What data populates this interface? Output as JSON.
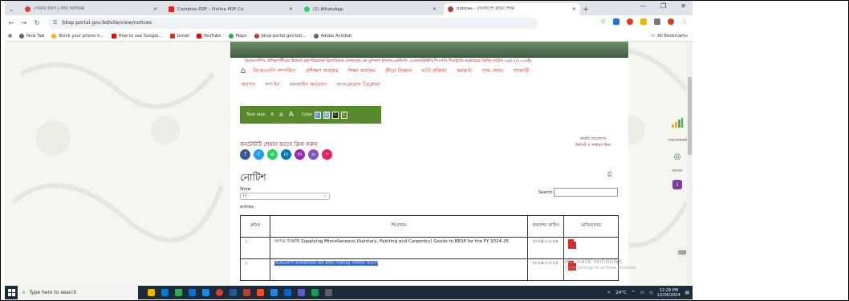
{
  "tabs": [
    {
      "title": "সোনার হরিণ | বাবি বিশেষজ্ঞ",
      "color": "#e23b2e",
      "active": false
    },
    {
      "title": "Combine PDF – Online PDF Co",
      "color": "#e2231a",
      "active": false
    },
    {
      "title": "(2) WhatsApp",
      "color": "#25d366",
      "active": false
    },
    {
      "title": "notices - বাংলাদেশ ক্রীড়া শিক্ষা",
      "color": "#c0392b",
      "active": true
    }
  ],
  "address": {
    "url": "bksp.portal.gov.bd/site/view/notices"
  },
  "bookmarks": [
    {
      "label": "New Tab",
      "color": "#5f6368"
    },
    {
      "label": "Block your phone n...",
      "color": "#f5b400"
    },
    {
      "label": "How to use Google...",
      "color": "#ff0000"
    },
    {
      "label": "Gmail",
      "color": "#d93025"
    },
    {
      "label": "YouTube",
      "color": "#ff0000"
    },
    {
      "label": "Maps",
      "color": "#34a853"
    },
    {
      "label": "bksp.portal.gov.bd/...",
      "color": "#c0392b"
    },
    {
      "label": "Adobe Acrobat",
      "color": "#5f6368"
    }
  ],
  "all_bookmarks": "All Bookmarks",
  "site": {
    "marquee": "বিকেএসপি'র প্রশিক্ষণার্থীদের উদ্দেশে মহাপরিচালক ব্রিগেডিয়ার জেনারেল মো.মুনিরুল ইসলাম,এনডিসি ,এএফডব্লিউসি,পিএসসি,পিএইচডি মহোদয়ের ব্রিফিং   তারিখ:২৯/০২/২০২৪ইং",
    "menu1": [
      "বিকেএসপি সম্পর্কিত",
      "প্রশিক্ষণ কার্যক্রম",
      "শিক্ষা কার্যক্রম",
      "ক্রীড়া বিজ্ঞান",
      "ভর্তি প্রক্রিয়া",
      "কর্মকর্তা",
      "তথ্য প্রদান",
      "গ্যালারী"
    ],
    "menu2": [
      "অ্যাপস",
      "লগ ইন",
      "অনলাইন আবেদন",
      "আনকোরাল ডিপ্লোমা"
    ],
    "textsize": {
      "label": "Text size",
      "a_small": "A",
      "a_mid": "A",
      "a_big": "A",
      "color_label": "Color",
      "color_opts": [
        "C",
        "C",
        "C",
        "C"
      ]
    },
    "share_text": "কনটেন্টটি শেয়ার করতে ক্লিক করুন",
    "side_info": "জরুরি প্রয়োজনে ভিজিট ও সাধারণ ফিড",
    "notice_title": "নোটিশ",
    "show_label": "Show",
    "show_value": "10",
    "entries_label": "entries",
    "search_label": "Search:",
    "table": {
      "headers": [
        "ক্রমিক",
        "শিরোনাম",
        "প্রকাশের তারিখ",
        "ডাউনলোড"
      ],
      "rows": [
        {
          "sn": "১",
          "title": "দরপত্র বিজ্ঞপ্তি Supplying Miscellaneous (Sanitary, Painting and Carpentry) Goods to BKSP for the FY 2024-25",
          "date": "২০২৪-১২-২৬",
          "highlight": false
        },
        {
          "sn": "২",
          "title": "বিকেএসপি আন্তর্জাতিক বিশ্ব ক্রীড়া সপ্তাহের সরকারি আদেশ",
          "date": "২০২৪-১২-২৫",
          "highlight": true
        }
      ]
    }
  },
  "right_panel": {
    "item1": "সেবাপ্রদানকারী",
    "item2": "মতামত"
  },
  "activate": {
    "line1": "Activate Windows",
    "line2": "Go to Settings to activate Windows."
  },
  "taskbar": {
    "search_placeholder": "Type here to search",
    "weather": "24°C",
    "time": "12:29 PM",
    "date": "12/26/2024",
    "app_colors": [
      "#f5b400",
      "#0078d4",
      "#33aa55",
      "#0a6ed1",
      "#1e88e5",
      "#e23b2e",
      "#2b579a",
      "#c0392b",
      "#f25022",
      "#1e88e5",
      "#0066cc",
      "#5b5fc7",
      "#0f9d58",
      "#606060"
    ]
  }
}
